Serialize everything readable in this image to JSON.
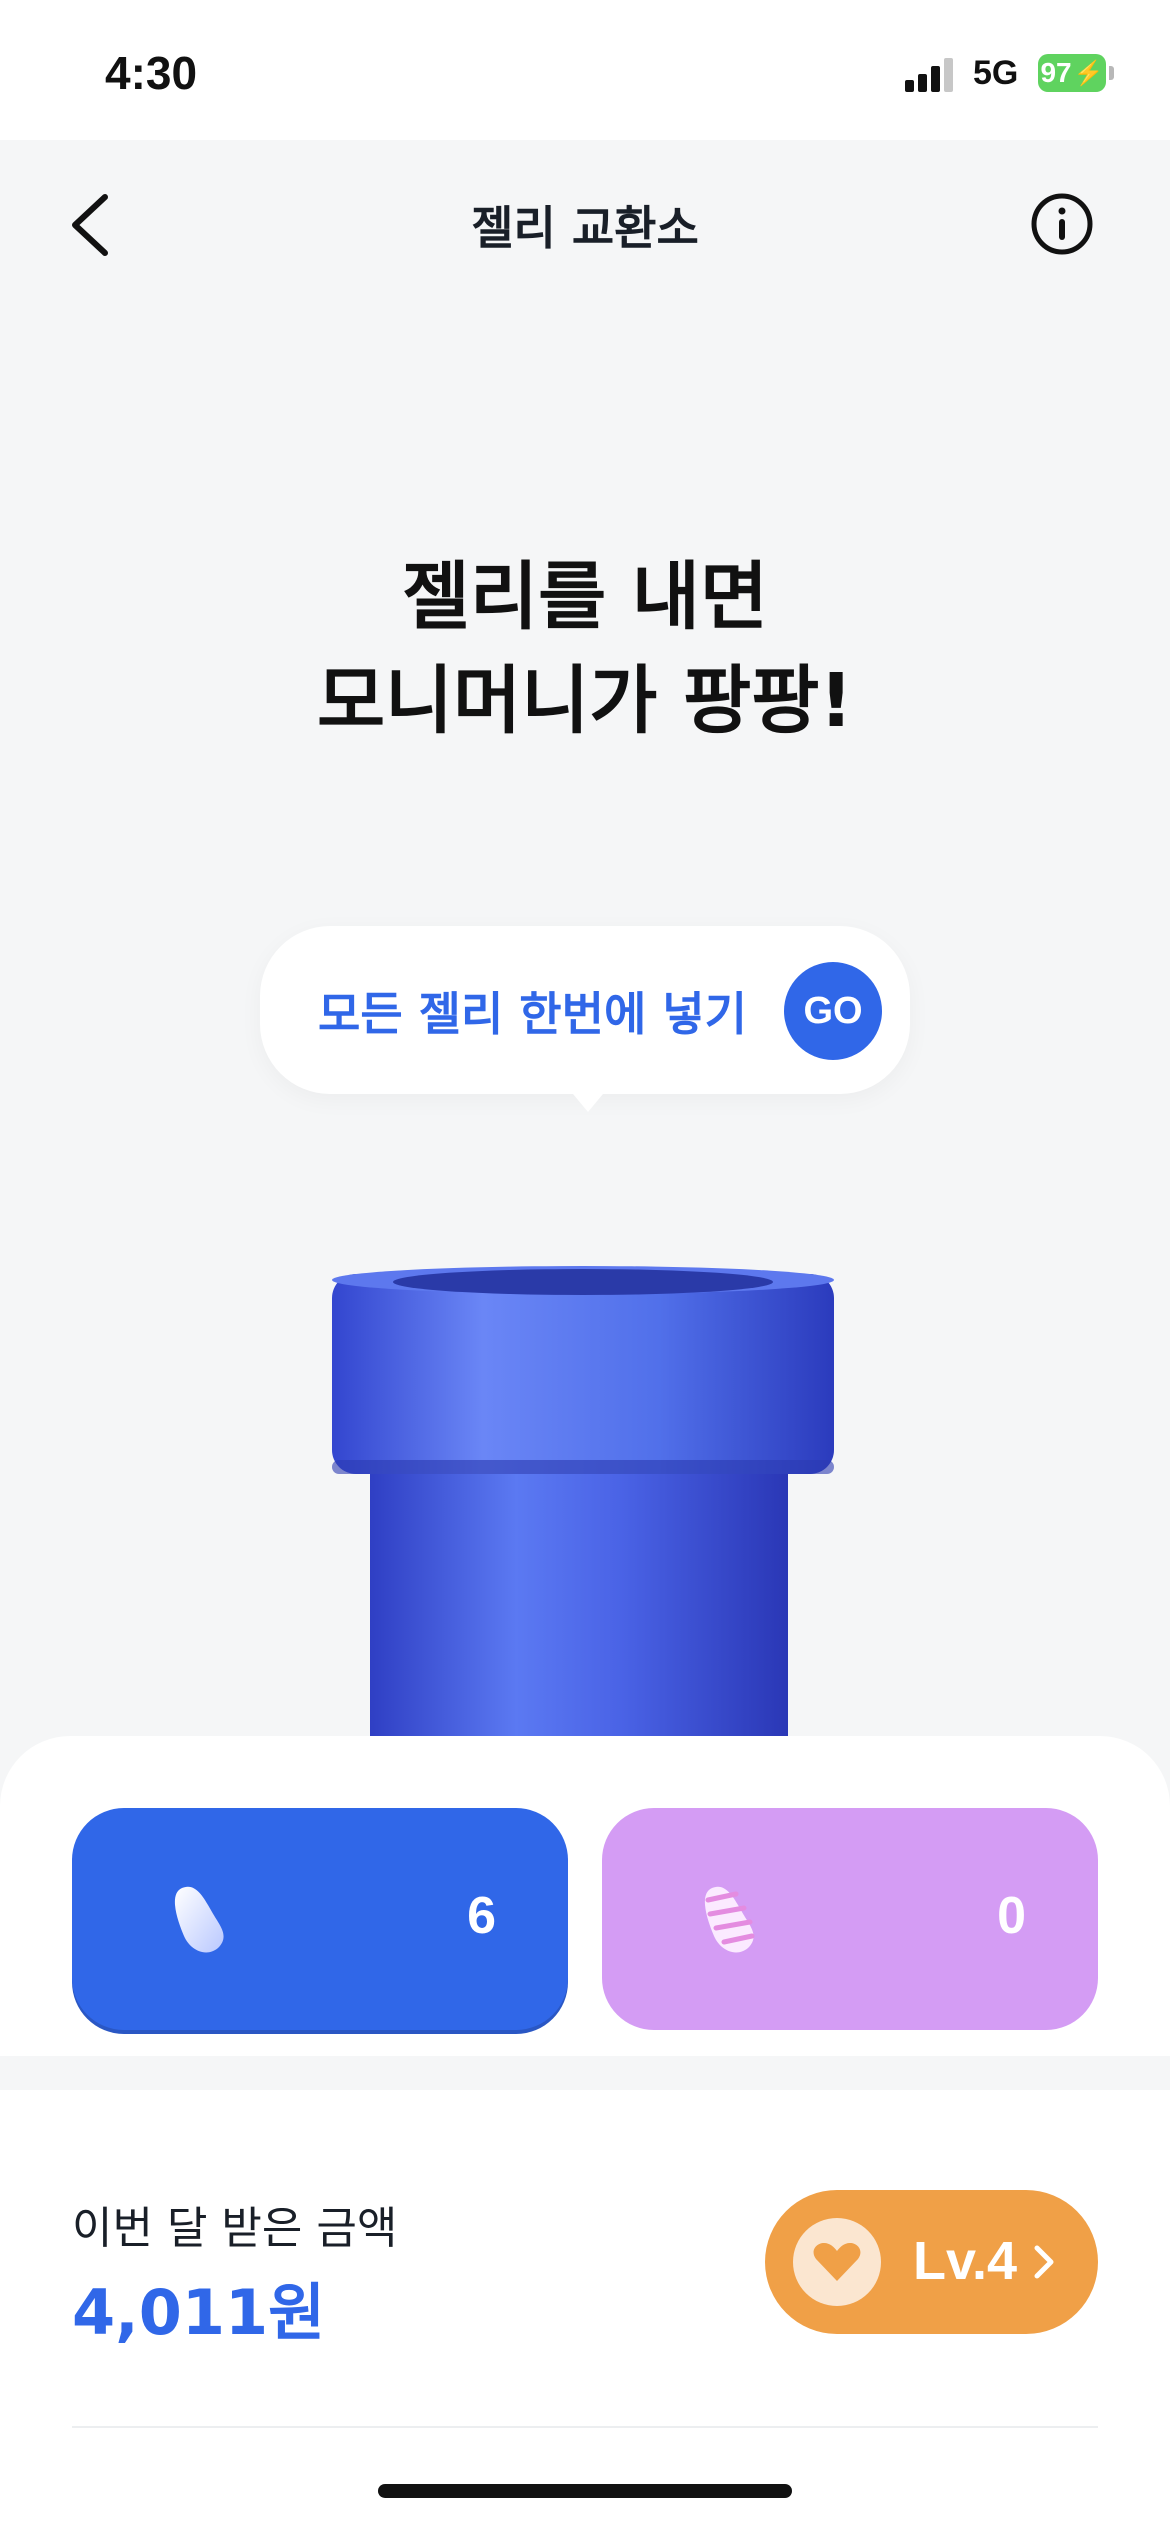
{
  "status_bar": {
    "time": "4:30",
    "network": "5G",
    "battery": "97"
  },
  "nav": {
    "title": "젤리 교환소",
    "back_icon": "chevron-left-icon",
    "info_icon": "info-circle-icon"
  },
  "hero": {
    "title_line1": "젤리를 내면",
    "title_line2": "모니머니가 팡팡!"
  },
  "cta": {
    "label": "모든 젤리 한번에 넣기",
    "button": "GO"
  },
  "jellies": [
    {
      "icon": "blue-jelly-icon",
      "count": "6",
      "color": "#3067e8"
    },
    {
      "icon": "pink-jelly-icon",
      "count": "0",
      "color": "#d49cf4"
    }
  ],
  "earnings": {
    "label": "이번 달 받은 금액",
    "value": "4,011원"
  },
  "level": {
    "label": "Lv.4",
    "icon": "heart-badge-icon",
    "color": "#f0a047"
  },
  "colors": {
    "accent": "#3067e8",
    "background": "#f5f6f7"
  }
}
